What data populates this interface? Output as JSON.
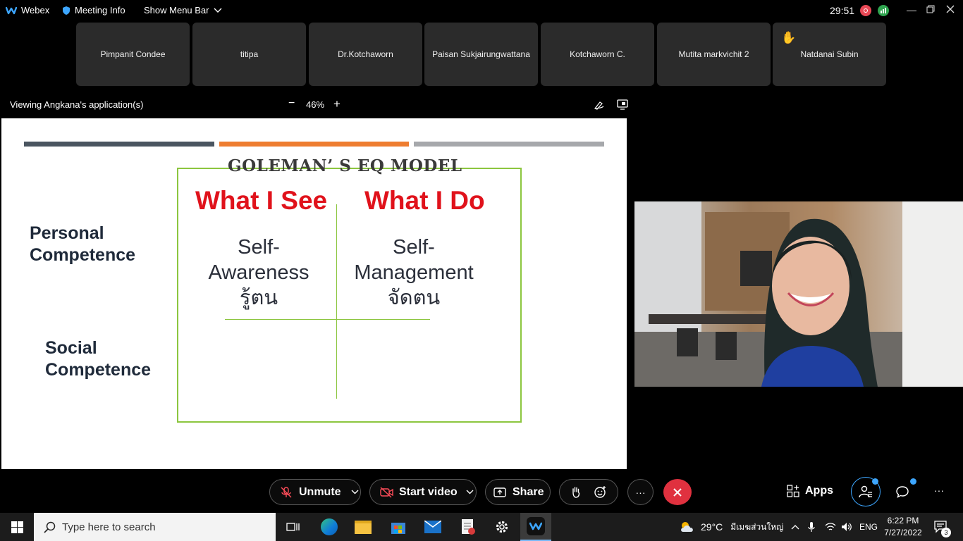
{
  "topbar": {
    "app_name": "Webex",
    "meeting_info": "Meeting Info",
    "show_menu_bar": "Show Menu Bar",
    "timer": "29:51"
  },
  "participants": [
    {
      "name": "Pimpanit Condee"
    },
    {
      "name": "titipa"
    },
    {
      "name": "Dr.Kotchaworn"
    },
    {
      "name": "Paisan Sukjairungwattana"
    },
    {
      "name": "Kotchaworn C."
    },
    {
      "name": "Mutita markvichit 2"
    },
    {
      "name": "Natdanai Subin",
      "hand_raised": true
    }
  ],
  "viewbar": {
    "viewing_text": "Viewing Angkana's application(s)",
    "zoom_minus": "−",
    "zoom_level": "46%",
    "zoom_plus": "+"
  },
  "slide": {
    "title": "GOLEMAN’ S EQ MODEL",
    "col_left_header": "What I See",
    "col_right_header": "What I Do",
    "row_top_label_1": "Personal",
    "row_top_label_2": "Competence",
    "row_bottom_label_1": "Social",
    "row_bottom_label_2": "Competence",
    "cell_left_1": "Self-",
    "cell_left_2": "Awareness",
    "cell_left_3": "รู้ตน",
    "cell_right_1": "Self-",
    "cell_right_2": "Management",
    "cell_right_3": "จัดตน",
    "bar_colors": [
      "#4a5560",
      "#ee7d30",
      "#a6a8ab"
    ],
    "header_color": "#e0121b",
    "grid_color": "#8cc63f"
  },
  "controls": {
    "unmute": "Unmute",
    "start_video": "Start video",
    "share": "Share",
    "apps": "Apps",
    "more": "···"
  },
  "taskbar": {
    "search_placeholder": "Type here to search",
    "weather": "29°C",
    "weather_place": "มีเมฆส่วนใหญ่",
    "language": "ENG",
    "time": "6:22 PM",
    "date": "7/27/2022",
    "notification_count": "3"
  }
}
